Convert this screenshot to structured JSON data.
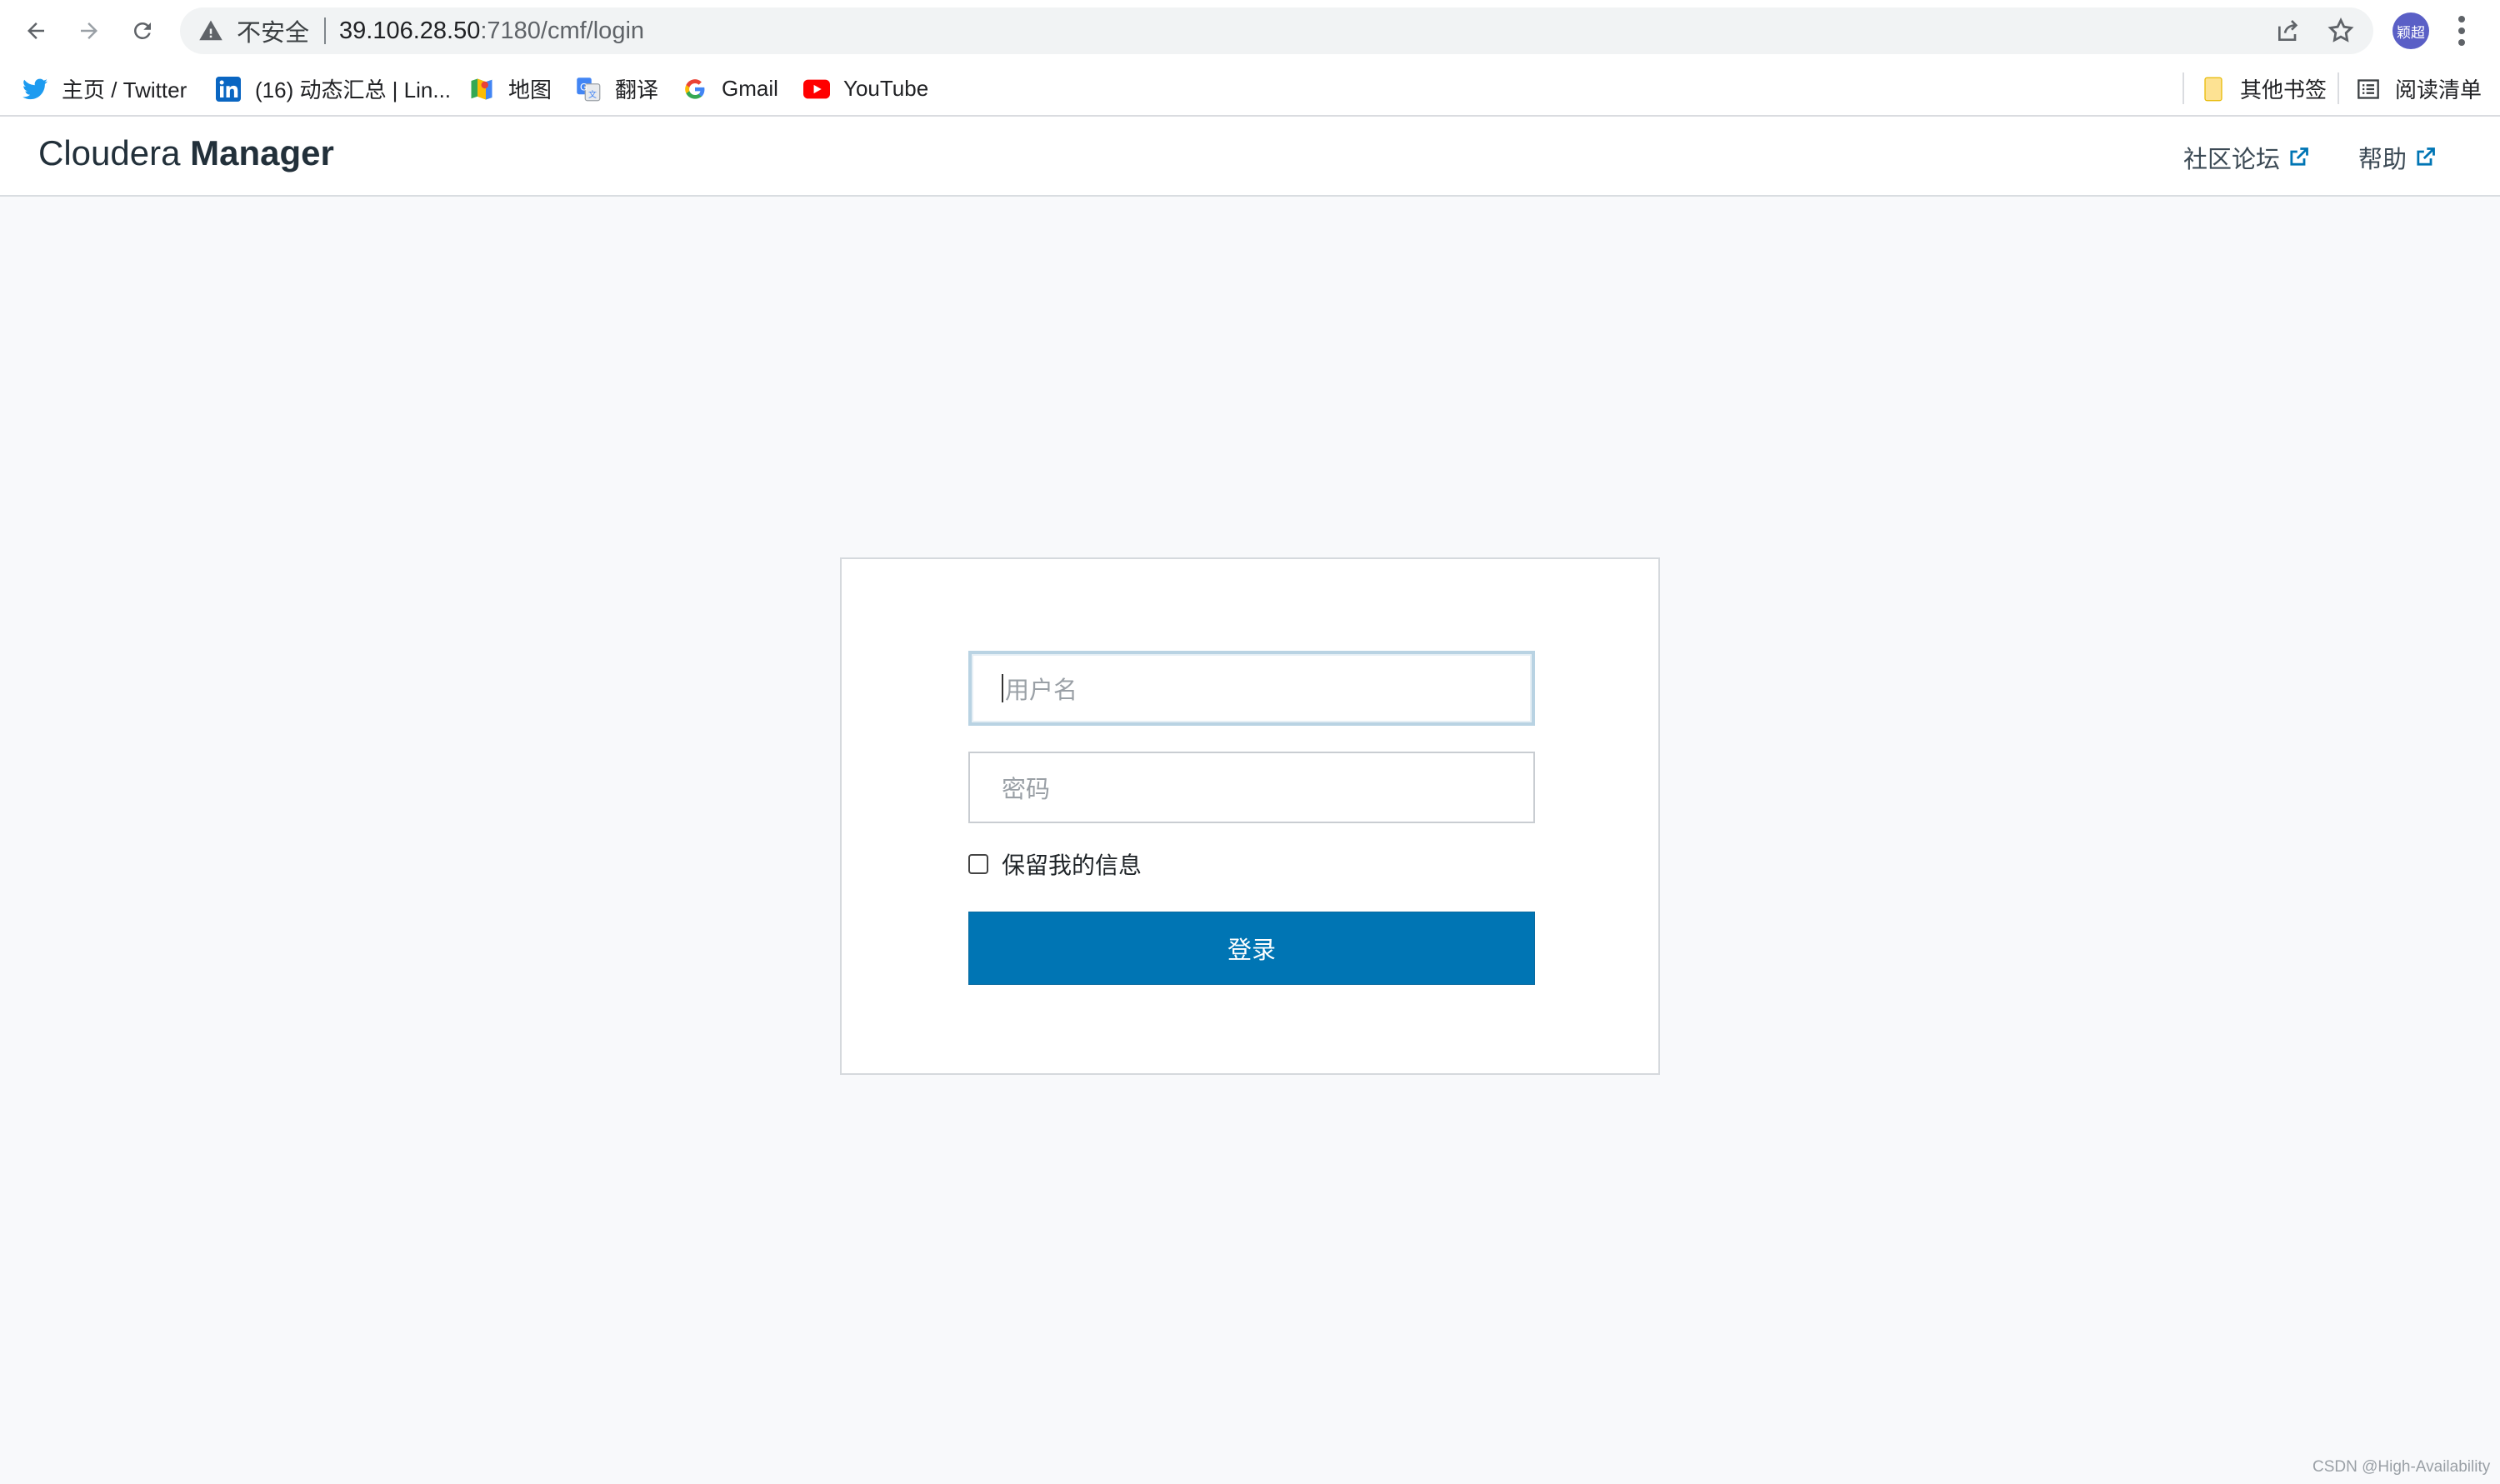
{
  "browser": {
    "security_label": "不安全",
    "url_host": "39.106.28.50",
    "url_path": ":7180/cmf/login",
    "profile_initials": "颖超",
    "bookmarks": [
      {
        "label": "主页 / Twitter",
        "icon": "twitter-icon"
      },
      {
        "label": "(16) 动态汇总 | Lin...",
        "icon": "linkedin-icon"
      },
      {
        "label": "地图",
        "icon": "maps-icon"
      },
      {
        "label": "翻译",
        "icon": "translate-icon"
      },
      {
        "label": "Gmail",
        "icon": "google-icon"
      },
      {
        "label": "YouTube",
        "icon": "youtube-icon"
      }
    ],
    "other_bookmarks": "其他书签",
    "reading_list": "阅读清单"
  },
  "header": {
    "brand_light": "Cloudera",
    "brand_bold": "Manager",
    "community_link": "社区论坛",
    "help_link": "帮助"
  },
  "login": {
    "username_placeholder": "用户名",
    "password_placeholder": "密码",
    "remember_label": "保留我的信息",
    "submit_label": "登录"
  },
  "watermark": "CSDN @High-Availability",
  "colors": {
    "primary_button": "#0075b4",
    "page_background": "#f8f9fb"
  }
}
